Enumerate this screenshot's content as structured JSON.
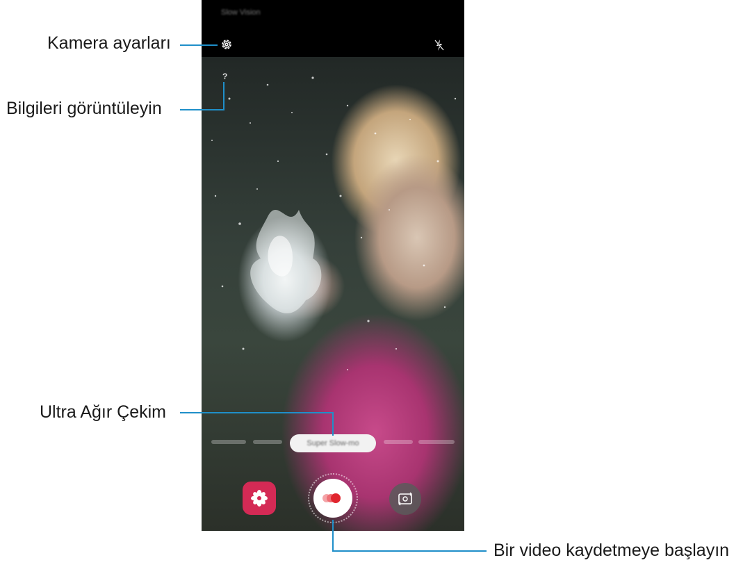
{
  "callouts": {
    "settings": "Kamera ayarları",
    "info": "Bilgileri görüntüleyin",
    "mode": "Ultra Ağır Çekim",
    "record": "Bir video kaydetmeye başlayın"
  },
  "phone": {
    "mode_title": "Slow Vision",
    "info_symbol": "?",
    "selected_mode_label": "Super Slow-mo",
    "icons": {
      "settings": "gear-icon",
      "flash": "flash-off-icon",
      "gallery": "flower-icon",
      "record": "record-icon",
      "switch": "switch-camera-icon"
    }
  },
  "colors": {
    "callout_line": "#1f8fc9",
    "gallery_bg": "#d42a55",
    "record_dot": "#e0252e"
  }
}
